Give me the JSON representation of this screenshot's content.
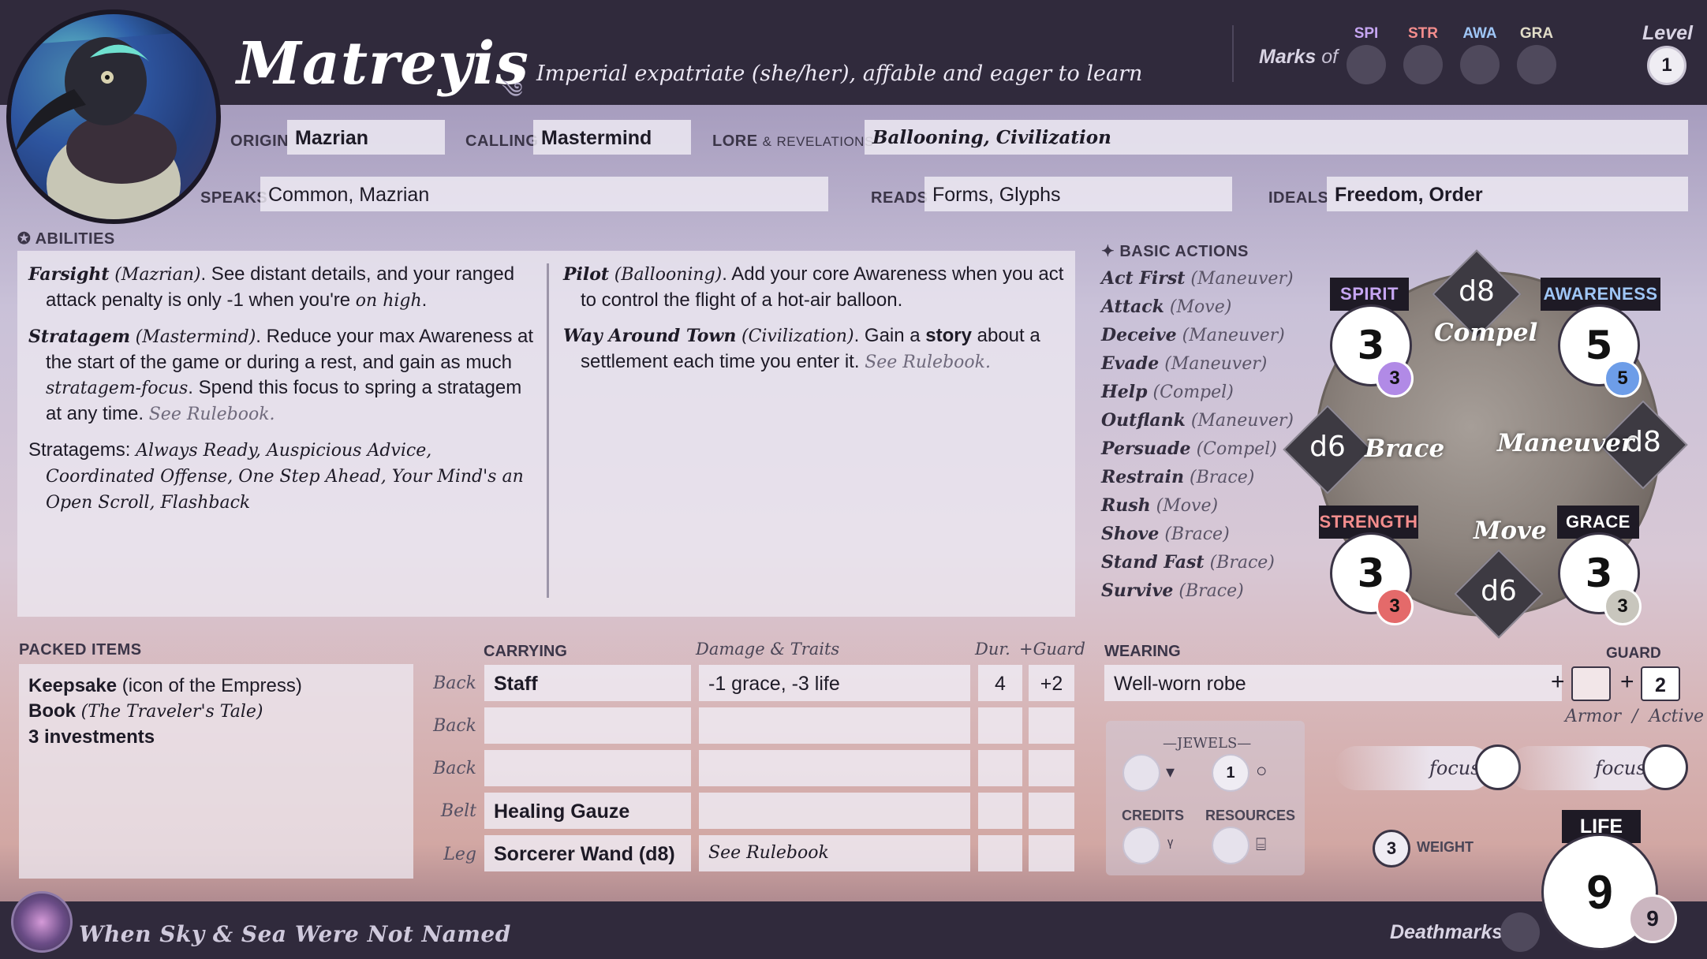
{
  "header": {
    "name": "Matreyis",
    "tagline": "Imperial expatriate (she/her), affable and eager to learn",
    "marks_label": "Marks",
    "marks_of": "of",
    "marks": [
      "SPI",
      "STR",
      "AWA",
      "GRA"
    ],
    "mark_colors": [
      "#c6a6f2",
      "#f48d8d",
      "#9fc6f6",
      "#e1dcc8"
    ],
    "level_label": "Level",
    "level": "1"
  },
  "identity": {
    "origin_label": "ORIGIN",
    "origin": "Mazrian",
    "calling_label": "CALLING",
    "calling": "Mastermind",
    "lore_label": "LORE",
    "lore_amp": "&",
    "revelations_label": "REVELATIONS",
    "lore": "Ballooning, Civilization",
    "speaks_label": "SPEAKS",
    "speaks": "Common, Mazrian",
    "reads_label": "READS",
    "reads": "Forms, Glyphs",
    "ideals_label": "IDEALS",
    "ideals": "Freedom, Order"
  },
  "abilities": {
    "label": "ABILITIES",
    "farsight_name": "Farsight",
    "farsight_src": "(Mazrian)",
    "farsight_text": ". See distant details, and your ranged attack penalty is only -1 when you're",
    "farsight_em": "on high",
    "stratagem_name": "Stratagem",
    "stratagem_src": "(Mastermind)",
    "stratagem_text": ". Reduce your max Awareness at the start of the game or during a rest, and gain as much",
    "stratagem_em": "stratagem-focus",
    "stratagem_text2": ". Spend this focus to spring a stratagem at any time.",
    "see_rulebook": "See Rulebook.",
    "stratagems_label": "Stratagems:",
    "stratagems_list": "Always Ready, Auspicious Advice, Coordinated Offense, One Step Ahead, Your Mind's an Open Scroll, Flashback",
    "pilot_name": "Pilot",
    "pilot_src": "(Ballooning)",
    "pilot_text": ". Add your core Awareness when you act to control the flight of a hot-air balloon.",
    "way_name": "Way Around Town",
    "way_src": "(Civilization)",
    "way_text1": ". Gain a",
    "way_bold": "story",
    "way_text2": "about a settlement each time you enter it."
  },
  "basic_actions": {
    "label": "BASIC ACTIONS",
    "items": [
      {
        "name": "Act First",
        "type": "(Maneuver)"
      },
      {
        "name": "Attack",
        "type": "(Move)"
      },
      {
        "name": "Deceive",
        "type": "(Maneuver)"
      },
      {
        "name": "Evade",
        "type": "(Maneuver)"
      },
      {
        "name": "Help",
        "type": "(Compel)"
      },
      {
        "name": "Outflank",
        "type": "(Maneuver)"
      },
      {
        "name": "Persuade",
        "type": "(Compel)"
      },
      {
        "name": "Restrain",
        "type": "(Brace)"
      },
      {
        "name": "Rush",
        "type": "(Move)"
      },
      {
        "name": "Shove",
        "type": "(Brace)"
      },
      {
        "name": "Stand Fast",
        "type": "(Brace)"
      },
      {
        "name": "Survive",
        "type": "(Brace)"
      }
    ]
  },
  "stats": {
    "spirit": {
      "label": "SPIRIT",
      "value": "3",
      "max": "3",
      "label_color": "#c6a6f2",
      "badge_color": "#b18ae6"
    },
    "awareness": {
      "label": "AWARENESS",
      "value": "5",
      "max": "5",
      "label_color": "#9fc6f6",
      "badge_color": "#6d9de8"
    },
    "strength": {
      "label": "STRENGTH",
      "value": "3",
      "max": "3",
      "label_color": "#f48d8d",
      "badge_color": "#e46a6a"
    },
    "grace": {
      "label": "GRACE",
      "value": "3",
      "max": "3",
      "label_color": "#ffffff",
      "badge_color": "#c8c6bd"
    },
    "compel": {
      "label": "Compel",
      "die": "d8"
    },
    "maneuver": {
      "label": "Maneuver",
      "die": "d8"
    },
    "brace": {
      "label": "Brace",
      "die": "d6"
    },
    "move": {
      "label": "Move",
      "die": "d6"
    }
  },
  "packed": {
    "label": "PACKED ITEMS",
    "keepsake": "Keepsake",
    "keepsake_desc": "(icon of the Empress)",
    "book": "Book",
    "book_desc": "(The Traveler's Tale)",
    "investments": "3 investments"
  },
  "carrying": {
    "label": "CARRYING",
    "damage_label": "Damage & Traits",
    "dur_label": "Dur.",
    "guard_label": "+Guard",
    "rows": [
      {
        "slot": "Back",
        "item": "Staff",
        "damage": "-1 grace, -3 life",
        "dur": "4",
        "guard": "+2"
      },
      {
        "slot": "Back",
        "item": "",
        "damage": "",
        "dur": "",
        "guard": ""
      },
      {
        "slot": "Back",
        "item": "",
        "damage": "",
        "dur": "",
        "guard": ""
      },
      {
        "slot": "Belt",
        "item": "Healing Gauze",
        "damage": "",
        "dur": "",
        "guard": ""
      },
      {
        "slot": "Leg",
        "item": "Sorcerer Wand (d8)",
        "damage": "See Rulebook",
        "dur": "",
        "guard": ""
      }
    ]
  },
  "wearing": {
    "label": "WEARING",
    "item": "Well-worn robe",
    "guard_label": "GUARD",
    "plus": "+",
    "armor_value": "",
    "active_value": "2",
    "armor_label": "Armor",
    "slash": "/",
    "active_label": "Active"
  },
  "treasury": {
    "jewels_label": "JEWELS",
    "jewels_value": "1",
    "credits_label": "CREDITS",
    "resources_label": "RESOURCES"
  },
  "focus": {
    "label1": "focus",
    "label2": "focus"
  },
  "weight": {
    "value": "3",
    "label": "WEIGHT"
  },
  "life": {
    "label": "LIFE",
    "value": "9",
    "max": "9"
  },
  "footer": {
    "title": "When Sky & Sea Were Not Named",
    "deathmarks_label": "Deathmarks"
  }
}
